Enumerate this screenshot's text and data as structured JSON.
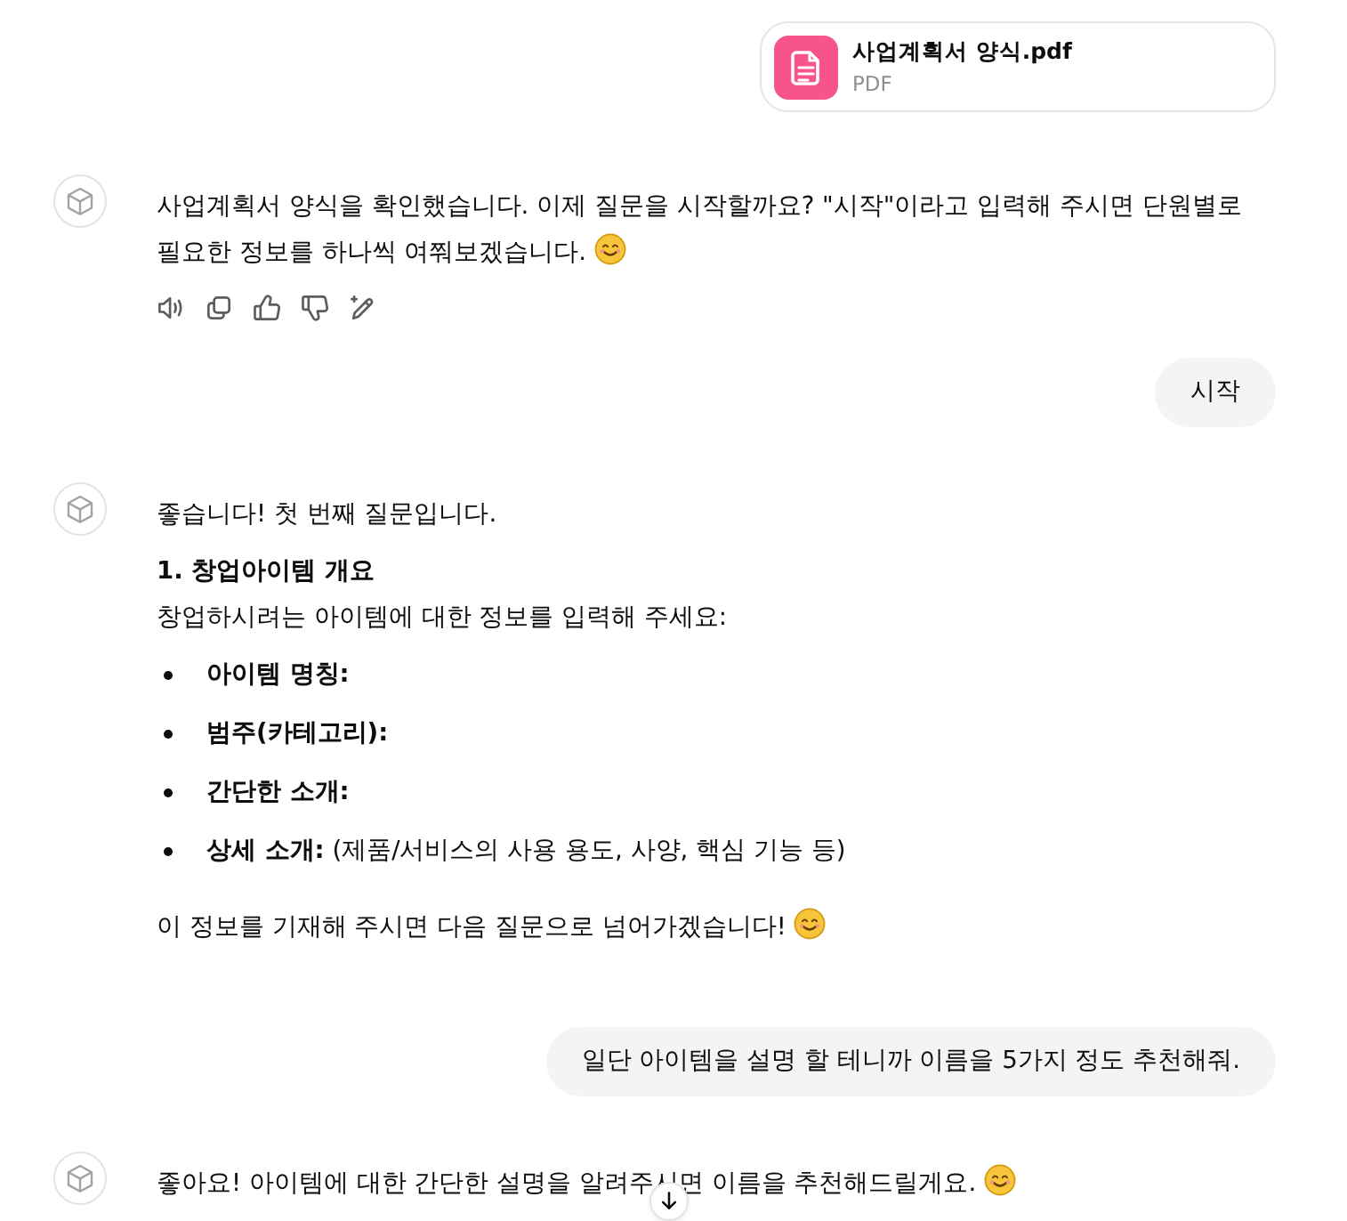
{
  "attachment": {
    "file_name": "사업계획서 양식.pdf",
    "file_type": "PDF"
  },
  "messages": [
    {
      "kind": "assistant",
      "show_actions": true,
      "blocks": [
        {
          "kind": "paragraph",
          "text": "사업계획서 양식을 확인했습니다. 이제 질문을 시작할까요? \"시작\"이라고 입력해 주시면 단원별로 필요한 정보를 하나씩 여쭤보겠습니다.",
          "trailing_emoji": true
        }
      ]
    },
    {
      "kind": "user",
      "text": "시작"
    },
    {
      "kind": "assistant",
      "show_actions": false,
      "blocks": [
        {
          "kind": "paragraph",
          "text": "좋습니다! 첫 번째 질문입니다."
        },
        {
          "kind": "heading",
          "text": "1. 창업아이템 개요"
        },
        {
          "kind": "paragraph",
          "text": "창업하시려는 아이템에 대한 정보를 입력해 주세요:"
        },
        {
          "kind": "list",
          "items": [
            {
              "label": "아이템 명칭:"
            },
            {
              "label": "범주(카테고리):"
            },
            {
              "label": "간단한 소개:"
            },
            {
              "label": "상세 소개:",
              "detail": "(제품/서비스의 사용 용도, 사양, 핵심 기능 등)"
            }
          ]
        },
        {
          "kind": "paragraph",
          "text": "이 정보를 기재해 주시면 다음 질문으로 넘어가겠습니다!",
          "trailing_emoji": true
        }
      ]
    },
    {
      "kind": "user",
      "text": "일단 아이템을 설명 할 테니까 이름을 5가지 정도 추천해줘."
    },
    {
      "kind": "assistant",
      "show_actions": false,
      "blocks": [
        {
          "kind": "paragraph",
          "text": "좋아요! 아이템에 대한 간단한 설명을 알려주시면 이름을 추천해드릴게요.",
          "trailing_emoji": true
        }
      ]
    }
  ],
  "scroll_down_button": true
}
